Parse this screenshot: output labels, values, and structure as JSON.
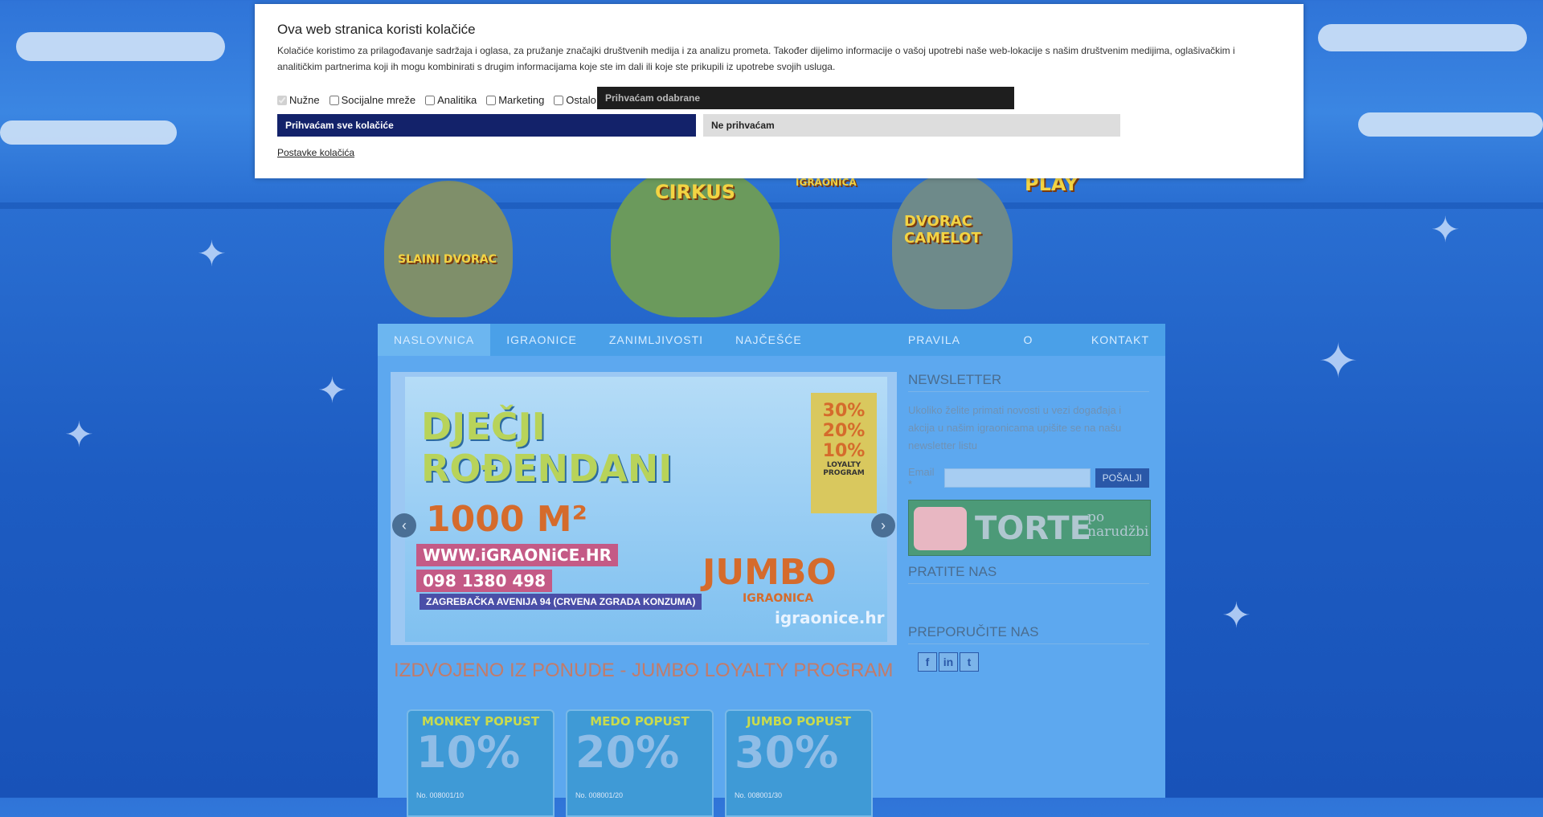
{
  "cookie_banner": {
    "title": "Ova web stranica koristi kolačiće",
    "body": "Kolačiće koristimo za prilagođavanje sadržaja i oglasa, za pružanje značajki društvenih medija i za analizu prometa. Također dijelimo informacije o vašoj upotrebi naše web-lokacije s našim društvenim medijima, oglašivačkim i analitičkim partnerima koji ih mogu kombinirati s drugim informacijama koje ste im dali ili koje ste prikupili iz upotrebe svojih usluga.",
    "options": [
      {
        "label": "Nužne",
        "checked": true,
        "disabled": true
      },
      {
        "label": "Socijalne mreže",
        "checked": false
      },
      {
        "label": "Analitika",
        "checked": false
      },
      {
        "label": "Marketing",
        "checked": false
      },
      {
        "label": "Ostalo",
        "checked": false
      }
    ],
    "accept_selected": "Prihvaćam odabrane",
    "accept_all": "Prihvaćam sve kolačiće",
    "reject": "Ne prihvaćam",
    "settings_link": "Postavke kolačića"
  },
  "banner": {
    "labels": [
      "CIRKUS",
      "PLAY",
      "DVORAC CAMELOT",
      "SLAINI DVORAC",
      "IGRAONICA"
    ]
  },
  "nav": {
    "items": [
      "NASLOVNICA",
      "IGRAONICE",
      "ZANIMLJIVOSTI",
      "NAJČEŠĆE POSTAVLJANA PITANJA",
      "PRAVILA IGRAONICA",
      "O NAMA",
      "KONTAKT"
    ],
    "active": "NASLOVNICA"
  },
  "slider": {
    "title_line1": "DJEČJI",
    "title_line2": "ROĐENDANI",
    "area": "1000 M²",
    "url": "WWW.iGRAONiCE.HR",
    "phone": "098 1380 498",
    "address": "ZAGREBAČKA AVENIJA 94 (CRVENA ZGRADA KONZUMA)",
    "jumbo": "JUMBO",
    "jumbo_sub": "IGRAONICA",
    "brand": "igraonice.hr",
    "loyalty": [
      "30%",
      "20%",
      "10%",
      "LOYALTY",
      "PROGRAM"
    ],
    "prev": "‹",
    "next": "›"
  },
  "featured": {
    "title": "IZDVOJENO IZ PONUDE - JUMBO LOYALTY PROGRAM",
    "cards": [
      {
        "title": "MONKEY POPUST",
        "pct": "10%",
        "no": "No. 008001/10"
      },
      {
        "title": "MEDO POPUST",
        "pct": "20%",
        "no": "No. 008001/20"
      },
      {
        "title": "JUMBO POPUST",
        "pct": "30%",
        "no": "No. 008001/30"
      }
    ]
  },
  "sidebar": {
    "newsletter_title": "NEWSLETTER",
    "newsletter_text": "Ukoliko želite primati novosti u vezi događaja i akcija u našim igraonicama upišite se na našu newsletter listu",
    "email_label": "Email *",
    "email_value": "",
    "send_label": "POŠALJI",
    "torte_title": "TORTE",
    "torte_sub": "po narudžbi",
    "follow_title": "PRATITE NAS",
    "recommend_title": "PREPORUČITE NAS",
    "social": [
      "f",
      "in",
      "t"
    ]
  }
}
